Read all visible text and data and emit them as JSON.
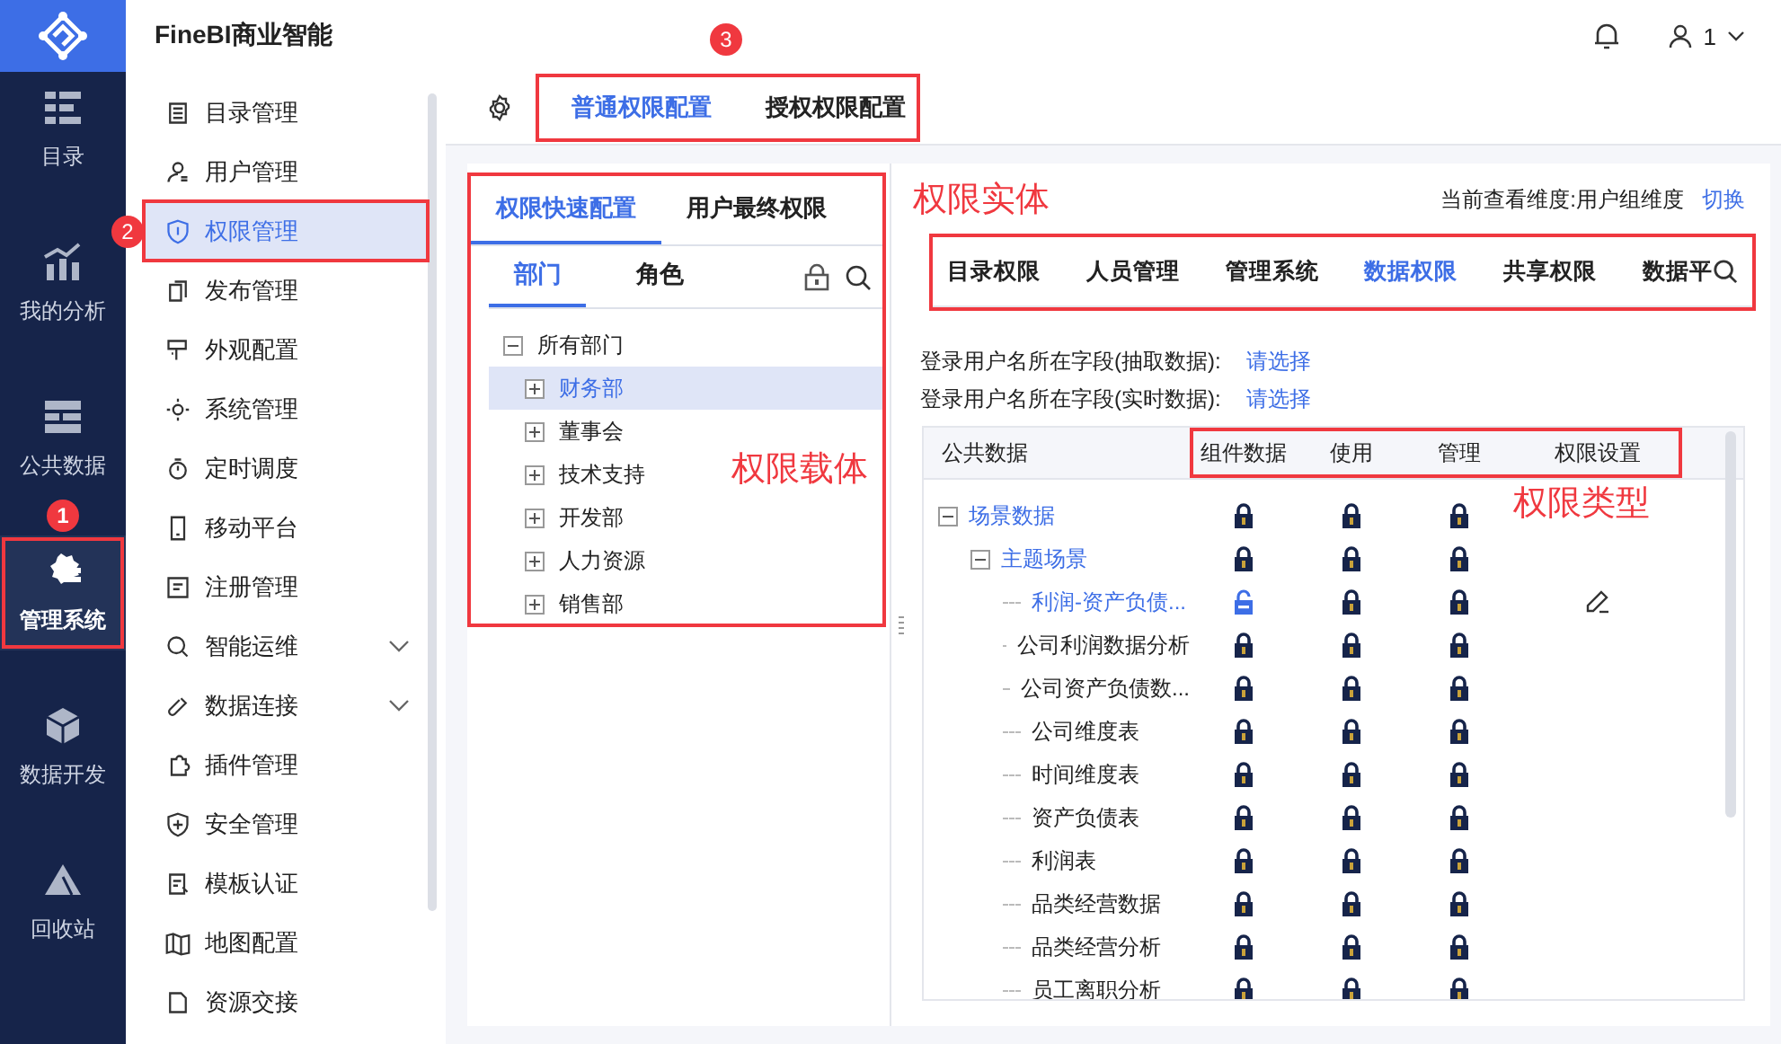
{
  "app": {
    "title": "FineBI商业智能",
    "user": "1"
  },
  "nav": [
    {
      "label": "目录",
      "selected": false,
      "outlined": false
    },
    {
      "label": "我的分析",
      "selected": false,
      "outlined": false
    },
    {
      "label": "公共数据",
      "selected": false,
      "outlined": false
    },
    {
      "label": "管理系统",
      "selected": true,
      "outlined": true,
      "marker": "1"
    },
    {
      "label": "数据开发",
      "selected": false,
      "outlined": false
    },
    {
      "label": "回收站",
      "selected": false,
      "outlined": false
    }
  ],
  "sidebar": [
    {
      "label": "目录管理",
      "selected": false,
      "expandable": false,
      "outlined": false
    },
    {
      "label": "用户管理",
      "selected": false,
      "expandable": false,
      "outlined": false
    },
    {
      "label": "权限管理",
      "selected": true,
      "expandable": false,
      "outlined": true,
      "marker": "2"
    },
    {
      "label": "发布管理",
      "selected": false,
      "expandable": false,
      "outlined": false
    },
    {
      "label": "外观配置",
      "selected": false,
      "expandable": false,
      "outlined": false
    },
    {
      "label": "系统管理",
      "selected": false,
      "expandable": false,
      "outlined": false
    },
    {
      "label": "定时调度",
      "selected": false,
      "expandable": false,
      "outlined": false
    },
    {
      "label": "移动平台",
      "selected": false,
      "expandable": false,
      "outlined": false
    },
    {
      "label": "注册管理",
      "selected": false,
      "expandable": false,
      "outlined": false
    },
    {
      "label": "智能运维",
      "selected": false,
      "expandable": true,
      "outlined": false
    },
    {
      "label": "数据连接",
      "selected": false,
      "expandable": true,
      "outlined": false
    },
    {
      "label": "插件管理",
      "selected": false,
      "expandable": false,
      "outlined": false
    },
    {
      "label": "安全管理",
      "selected": false,
      "expandable": false,
      "outlined": false
    },
    {
      "label": "模板认证",
      "selected": false,
      "expandable": false,
      "outlined": false
    },
    {
      "label": "地图配置",
      "selected": false,
      "expandable": false,
      "outlined": false
    },
    {
      "label": "资源交接",
      "selected": false,
      "expandable": false,
      "outlined": false
    }
  ],
  "top_tabs": {
    "outlined": true,
    "marker": "3",
    "items": [
      {
        "label": "普通权限配置",
        "selected": true
      },
      {
        "label": "授权权限配置",
        "selected": false
      }
    ]
  },
  "carrier_panel": {
    "outlined": true,
    "callout": "权限载体",
    "tabs": [
      {
        "label": "权限快速配置",
        "selected": true
      },
      {
        "label": "用户最终权限",
        "selected": false
      }
    ],
    "subtabs": [
      {
        "label": "部门",
        "selected": true
      },
      {
        "label": "角色",
        "selected": false
      }
    ],
    "tree": {
      "label": "所有部门",
      "expanded": true,
      "children": [
        {
          "label": "财务部",
          "selected": true,
          "expanded": false
        },
        {
          "label": "董事会",
          "selected": false,
          "expanded": false
        },
        {
          "label": "技术支持",
          "selected": false,
          "expanded": false
        },
        {
          "label": "开发部",
          "selected": false,
          "expanded": false
        },
        {
          "label": "人力资源",
          "selected": false,
          "expanded": false
        },
        {
          "label": "销售部",
          "selected": false,
          "expanded": false
        }
      ]
    }
  },
  "entity_panel": {
    "callout": "权限实体",
    "dimension": "当前查看维度:用户组维度",
    "switch_link": "切换",
    "tabs": {
      "outlined": true,
      "items": [
        {
          "label": "目录权限",
          "selected": false
        },
        {
          "label": "人员管理",
          "selected": false
        },
        {
          "label": "管理系统",
          "selected": false
        },
        {
          "label": "数据权限",
          "selected": true
        },
        {
          "label": "共享权限",
          "selected": false
        },
        {
          "label": "数据平",
          "selected": false
        }
      ]
    },
    "fields": [
      {
        "label": "登录用户名所在字段(抽取数据):",
        "value": "请选择"
      },
      {
        "label": "登录用户名所在字段(实时数据):",
        "value": "请选择"
      }
    ],
    "table": {
      "callout": "权限类型",
      "columns_outlined": true,
      "columns": [
        "公共数据",
        "组件数据",
        "使用",
        "管理",
        "权限设置"
      ],
      "rows": [
        {
          "name": "场景数据",
          "highlighted": true,
          "expanded": true,
          "locked": [
            true,
            true,
            true
          ],
          "editable": false,
          "children": [
            {
              "name": "主题场景",
              "highlighted": true,
              "expanded": true,
              "locked": [
                true,
                true,
                true
              ],
              "editable": false,
              "children": [
                {
                  "name": "利润-资产负债...",
                  "highlighted": true,
                  "locked": [
                    false,
                    true,
                    true
                  ],
                  "editable": true
                },
                {
                  "name": "公司利润数据分析",
                  "highlighted": false,
                  "locked": [
                    true,
                    true,
                    true
                  ],
                  "editable": false
                },
                {
                  "name": "公司资产负债数...",
                  "highlighted": false,
                  "locked": [
                    true,
                    true,
                    true
                  ],
                  "editable": false
                },
                {
                  "name": "公司维度表",
                  "highlighted": false,
                  "locked": [
                    true,
                    true,
                    true
                  ],
                  "editable": false
                },
                {
                  "name": "时间维度表",
                  "highlighted": false,
                  "locked": [
                    true,
                    true,
                    true
                  ],
                  "editable": false
                },
                {
                  "name": "资产负债表",
                  "highlighted": false,
                  "locked": [
                    true,
                    true,
                    true
                  ],
                  "editable": false
                },
                {
                  "name": "利润表",
                  "highlighted": false,
                  "locked": [
                    true,
                    true,
                    true
                  ],
                  "editable": false
                },
                {
                  "name": "品类经营数据",
                  "highlighted": false,
                  "locked": [
                    true,
                    true,
                    true
                  ],
                  "editable": false
                },
                {
                  "name": "品类经营分析",
                  "highlighted": false,
                  "locked": [
                    true,
                    true,
                    true
                  ],
                  "editable": false
                },
                {
                  "name": "员工离职分析",
                  "highlighted": false,
                  "locked": [
                    true,
                    true,
                    true
                  ],
                  "editable": false
                }
              ]
            }
          ]
        }
      ]
    }
  }
}
